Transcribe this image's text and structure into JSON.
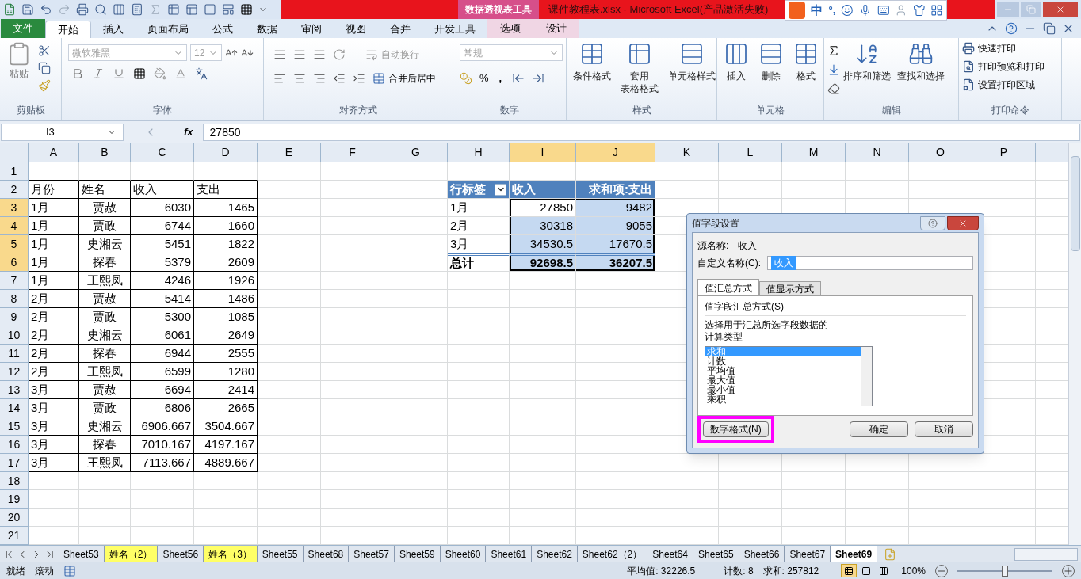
{
  "title_bar": {
    "contextual_label": "数据透视表工具",
    "title": "课件教程表.xlsx  -  Microsoft Excel(产品激活失败)",
    "ime_label": "中",
    "ime_punct": "°,"
  },
  "ribbon_tabs": [
    {
      "label": "文件",
      "kind": "file",
      "selected": false
    },
    {
      "label": "开始",
      "kind": "normal",
      "selected": true
    },
    {
      "label": "插入",
      "kind": "normal",
      "selected": false
    },
    {
      "label": "页面布局",
      "kind": "normal",
      "selected": false
    },
    {
      "label": "公式",
      "kind": "normal",
      "selected": false
    },
    {
      "label": "数据",
      "kind": "normal",
      "selected": false
    },
    {
      "label": "审阅",
      "kind": "normal",
      "selected": false
    },
    {
      "label": "视图",
      "kind": "normal",
      "selected": false
    },
    {
      "label": "合并",
      "kind": "normal",
      "selected": false
    },
    {
      "label": "开发工具",
      "kind": "normal",
      "selected": false
    },
    {
      "label": "选项",
      "kind": "contextual",
      "selected": false
    },
    {
      "label": "设计",
      "kind": "contextual",
      "selected": false
    }
  ],
  "clipboard": {
    "paste": "粘贴",
    "group": "剪贴板"
  },
  "font": {
    "name": "微软雅黑",
    "size": "12",
    "disabled": true,
    "group": "字体"
  },
  "alignment": {
    "wrap": "自动换行",
    "merge": "合并后居中",
    "group": "对齐方式"
  },
  "number": {
    "format": "常规",
    "disabled": true,
    "percent": "%",
    "comma": ",",
    "group": "数字"
  },
  "styles": {
    "items": [
      {
        "lines": [
          "条件格式"
        ]
      },
      {
        "lines": [
          "套用",
          "表格格式"
        ]
      },
      {
        "lines": [
          "单元格样式"
        ]
      }
    ],
    "group": "样式"
  },
  "cells": {
    "items": [
      "插入",
      "删除",
      "格式"
    ],
    "group": "单元格"
  },
  "editing": {
    "items": [
      "排序和筛选",
      "查找和选择"
    ],
    "group": "编辑"
  },
  "print": {
    "items": [
      "快速打印",
      "打印预览和打印",
      "设置打印区域"
    ],
    "group": "打印命令"
  },
  "formula_bar": {
    "name_box": "I3",
    "fx": "fx",
    "value": "27850"
  },
  "sheet": {
    "columns": [
      {
        "label": "A",
        "selected": false
      },
      {
        "label": "B",
        "selected": false
      },
      {
        "label": "C",
        "selected": false
      },
      {
        "label": "D",
        "selected": false
      },
      {
        "label": "E",
        "selected": false
      },
      {
        "label": "F",
        "selected": false
      },
      {
        "label": "G",
        "selected": false
      },
      {
        "label": "H",
        "selected": false
      },
      {
        "label": "I",
        "selected": true
      },
      {
        "label": "J",
        "selected": true
      },
      {
        "label": "K",
        "selected": false
      },
      {
        "label": "L",
        "selected": false
      },
      {
        "label": "M",
        "selected": false
      },
      {
        "label": "N",
        "selected": false
      },
      {
        "label": "O",
        "selected": false
      },
      {
        "label": "P",
        "selected": false
      }
    ],
    "rows": [
      {
        "label": "1",
        "selected": false
      },
      {
        "label": "2",
        "selected": false
      },
      {
        "label": "3",
        "selected": true
      },
      {
        "label": "4",
        "selected": true
      },
      {
        "label": "5",
        "selected": true
      },
      {
        "label": "6",
        "selected": true
      },
      {
        "label": "7",
        "selected": false
      },
      {
        "label": "8",
        "selected": false
      },
      {
        "label": "9",
        "selected": false
      },
      {
        "label": "10",
        "selected": false
      },
      {
        "label": "11",
        "selected": false
      },
      {
        "label": "12",
        "selected": false
      },
      {
        "label": "13",
        "selected": false
      },
      {
        "label": "14",
        "selected": false
      },
      {
        "label": "15",
        "selected": false
      },
      {
        "label": "16",
        "selected": false
      },
      {
        "label": "17",
        "selected": false
      },
      {
        "label": "18",
        "selected": false
      },
      {
        "label": "19",
        "selected": false
      },
      {
        "label": "20",
        "selected": false
      },
      {
        "label": "21",
        "selected": false
      }
    ]
  },
  "source_table": {
    "header": [
      "月份",
      "姓名",
      "收入",
      "支出"
    ],
    "rows": [
      [
        "1月",
        "贾赦",
        "6030",
        "1465"
      ],
      [
        "1月",
        "贾政",
        "6744",
        "1660"
      ],
      [
        "1月",
        "史湘云",
        "5451",
        "1822"
      ],
      [
        "1月",
        "探春",
        "5379",
        "2609"
      ],
      [
        "1月",
        "王熙凤",
        "4246",
        "1926"
      ],
      [
        "2月",
        "贾赦",
        "5414",
        "1486"
      ],
      [
        "2月",
        "贾政",
        "5300",
        "1085"
      ],
      [
        "2月",
        "史湘云",
        "6061",
        "2649"
      ],
      [
        "2月",
        "探春",
        "6944",
        "2555"
      ],
      [
        "2月",
        "王熙凤",
        "6599",
        "1280"
      ],
      [
        "3月",
        "贾赦",
        "6694",
        "2414"
      ],
      [
        "3月",
        "贾政",
        "6806",
        "2665"
      ],
      [
        "3月",
        "史湘云",
        "6906.667",
        "3504.667"
      ],
      [
        "3月",
        "探春",
        "7010.167",
        "4197.167"
      ],
      [
        "3月",
        "王熙凤",
        "7113.667",
        "4889.667"
      ]
    ]
  },
  "pivot": {
    "header": [
      "行标签",
      "收入",
      "求和项:支出"
    ],
    "rows": [
      [
        "1月",
        "27850",
        "9482"
      ],
      [
        "2月",
        "30318",
        "9055"
      ],
      [
        "3月",
        "34530.5",
        "17670.5"
      ]
    ],
    "total": [
      "总计",
      "92698.5",
      "36207.5"
    ]
  },
  "dialog": {
    "title": "值字段设置",
    "source_label": "源名称:",
    "source_value": "收入",
    "custom_name_label": "自定义名称(C):",
    "custom_name_value": "收入",
    "tabs": [
      {
        "label": "值汇总方式",
        "selected": true
      },
      {
        "label": "值显示方式",
        "selected": false
      }
    ],
    "section_label": "值字段汇总方式(S)",
    "description": "选择用于汇总所选字段数据的计算类型",
    "functions": [
      {
        "label": "求和",
        "selected": true
      },
      {
        "label": "计数",
        "selected": false
      },
      {
        "label": "平均值",
        "selected": false
      },
      {
        "label": "最大值",
        "selected": false
      },
      {
        "label": "最小值",
        "selected": false
      },
      {
        "label": "乘积",
        "selected": false
      }
    ],
    "buttons": [
      {
        "label": "数字格式(N)",
        "kind": "left",
        "highlighted": true
      },
      {
        "label": "确定",
        "kind": "right",
        "highlighted": false
      },
      {
        "label": "取消",
        "kind": "right",
        "highlighted": false
      }
    ]
  },
  "sheet_tabs": [
    {
      "label": "Sheet53",
      "selected": false
    },
    {
      "label": "姓名（2）",
      "selected": false,
      "color": "#ffff66"
    },
    {
      "label": "Sheet56",
      "selected": false
    },
    {
      "label": "姓名（3）",
      "selected": false,
      "color": "#ffff66"
    },
    {
      "label": "Sheet55",
      "selected": false
    },
    {
      "label": "Sheet68",
      "selected": false
    },
    {
      "label": "Sheet57",
      "selected": false
    },
    {
      "label": "Sheet59",
      "selected": false
    },
    {
      "label": "Sheet60",
      "selected": false
    },
    {
      "label": "Sheet61",
      "selected": false
    },
    {
      "label": "Sheet62",
      "selected": false
    },
    {
      "label": "Sheet62（2）",
      "selected": false
    },
    {
      "label": "Sheet64",
      "selected": false
    },
    {
      "label": "Sheet65",
      "selected": false
    },
    {
      "label": "Sheet66",
      "selected": false
    },
    {
      "label": "Sheet67",
      "selected": false
    },
    {
      "label": "Sheet69",
      "selected": true
    }
  ],
  "status_bar": {
    "mode": "就绪",
    "scroll": "滚动",
    "average": "平均值: 32226.5",
    "count": "计数: 8",
    "sum": "求和: 257812",
    "views": [
      {
        "kind": "normal",
        "selected": true
      },
      {
        "kind": "page_layout",
        "selected": false
      },
      {
        "kind": "page_break",
        "selected": false
      }
    ],
    "zoom": "100%",
    "level": 0.5
  }
}
